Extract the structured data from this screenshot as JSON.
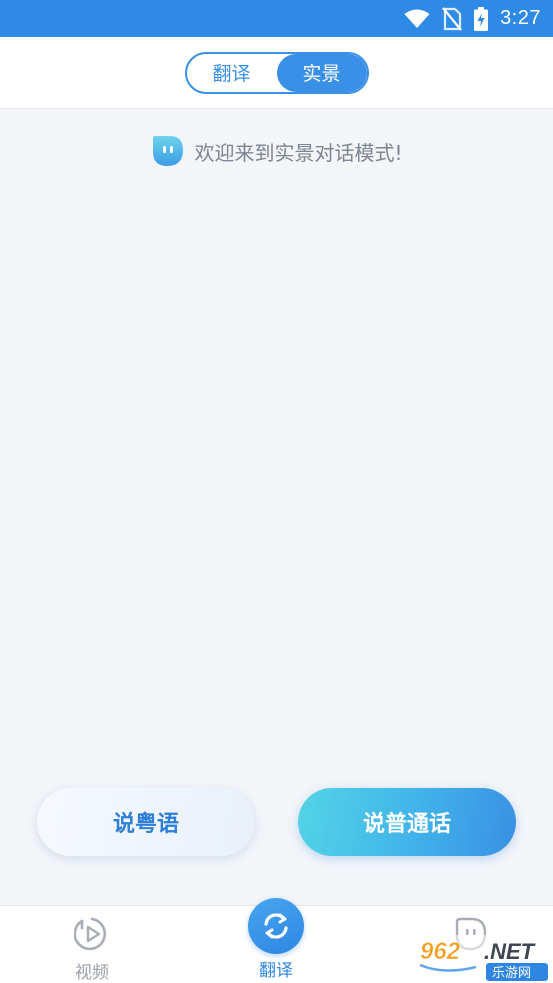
{
  "status_bar": {
    "time": "3:27",
    "background": "#2f8ae5",
    "icons": [
      "wifi-icon",
      "no-sim-icon",
      "battery-charging-icon"
    ]
  },
  "header": {
    "segments": [
      {
        "label": "翻译",
        "active": false
      },
      {
        "label": "实景",
        "active": true
      }
    ],
    "accent": "#3a8fe6"
  },
  "content": {
    "welcome_icon": "bot-face-icon",
    "welcome_text": "欢迎来到实景对话模式!"
  },
  "actions": {
    "cantonese_label": "说粤语",
    "mandarin_label": "说普通话"
  },
  "bottom_nav": {
    "items": [
      {
        "label": "视频",
        "icon": "video-play-icon",
        "active": false
      },
      {
        "label": "翻译",
        "icon": "refresh-translate-icon",
        "active": true
      }
    ]
  },
  "watermark": {
    "text_top": "962.NET",
    "text_bottom": "乐游网"
  }
}
